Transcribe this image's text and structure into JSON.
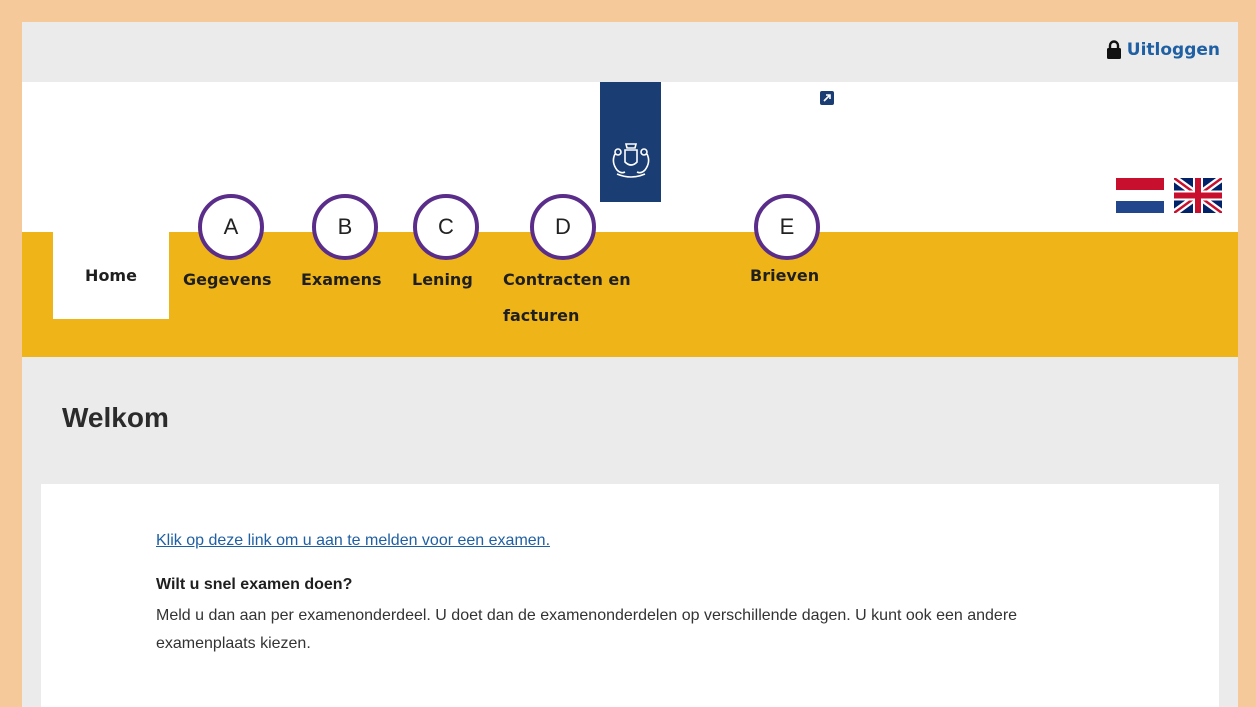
{
  "header": {
    "logout_label": "Uitloggen"
  },
  "nav": {
    "home": "Home",
    "items": [
      {
        "label": "Gegevens",
        "marker": "A"
      },
      {
        "label": "Examens",
        "marker": "B"
      },
      {
        "label": "Lening",
        "marker": "C"
      },
      {
        "label": "Contracten en facturen",
        "marker": "D"
      },
      {
        "label": "Brieven",
        "marker": "E"
      }
    ]
  },
  "main": {
    "title": "Welkom",
    "exam_link": "Klik op deze link om u aan te melden voor een examen.",
    "subheading": "Wilt u snel examen doen?",
    "paragraph": "Meld u dan aan per examenonderdeel. U doet dan de examenonderdelen op verschillende dagen. U kunt ook een andere examenplaats kiezen."
  },
  "colors": {
    "nav_bar": "#efb518",
    "logo_band": "#1a3d73",
    "link": "#1f5fa3",
    "marker_ring": "#5b2d8a",
    "frame": "#f6c99a"
  },
  "icons": [
    "lock-icon",
    "external-link-icon",
    "coat-of-arms-icon",
    "flag-nl-icon",
    "flag-uk-icon"
  ]
}
